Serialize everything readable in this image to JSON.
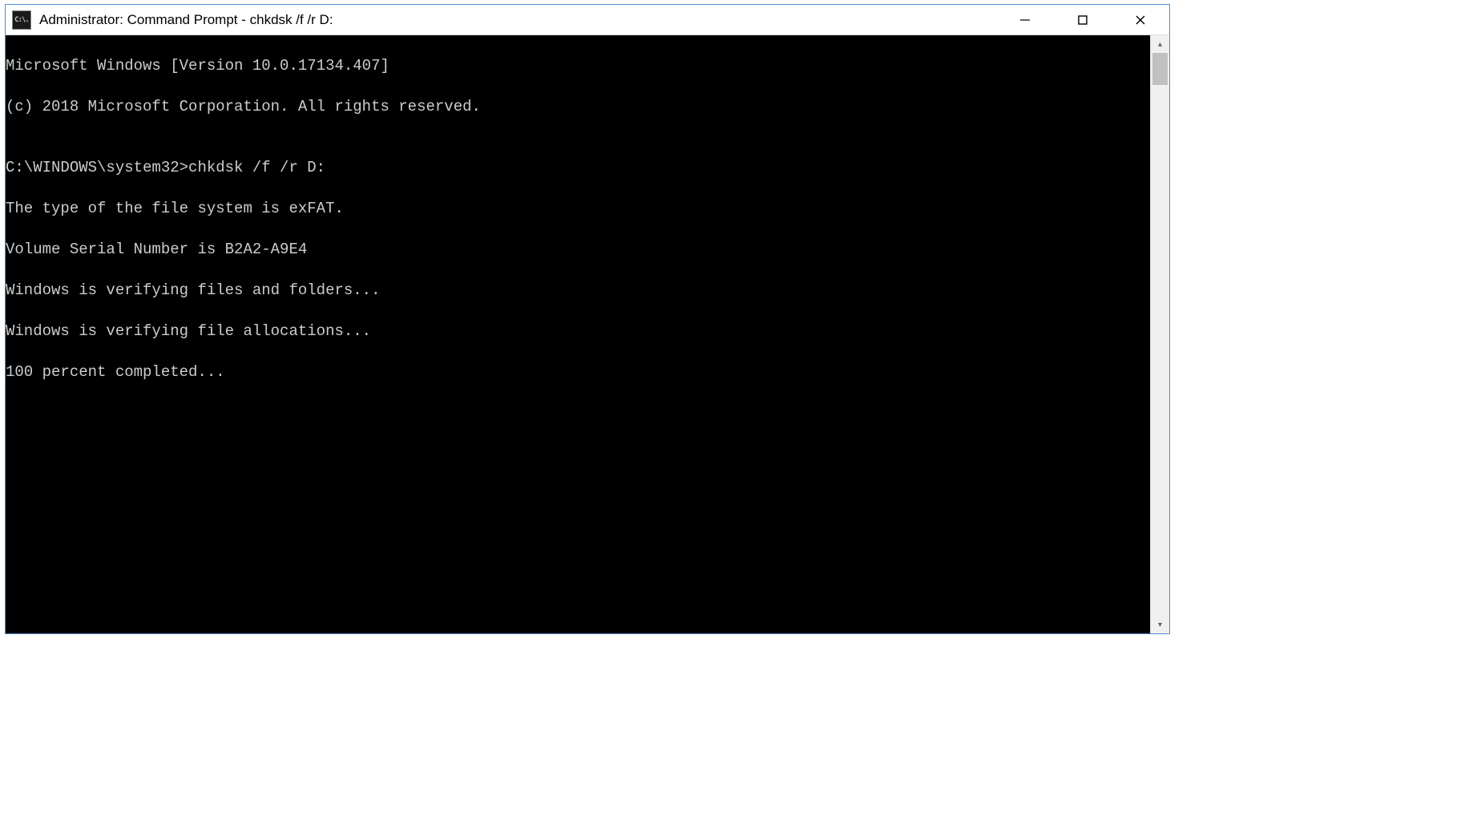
{
  "window": {
    "title": "Administrator: Command Prompt - chkdsk  /f /r D:",
    "icon_label": "C:\\."
  },
  "console": {
    "lines": [
      "Microsoft Windows [Version 10.0.17134.407]",
      "(c) 2018 Microsoft Corporation. All rights reserved.",
      "",
      "C:\\WINDOWS\\system32>chkdsk /f /r D:",
      "The type of the file system is exFAT.",
      "Volume Serial Number is B2A2-A9E4",
      "Windows is verifying files and folders...",
      "Windows is verifying file allocations...",
      "100 percent completed..."
    ]
  },
  "controls": {
    "minimize": "—",
    "maximize": "☐",
    "close": "✕"
  }
}
